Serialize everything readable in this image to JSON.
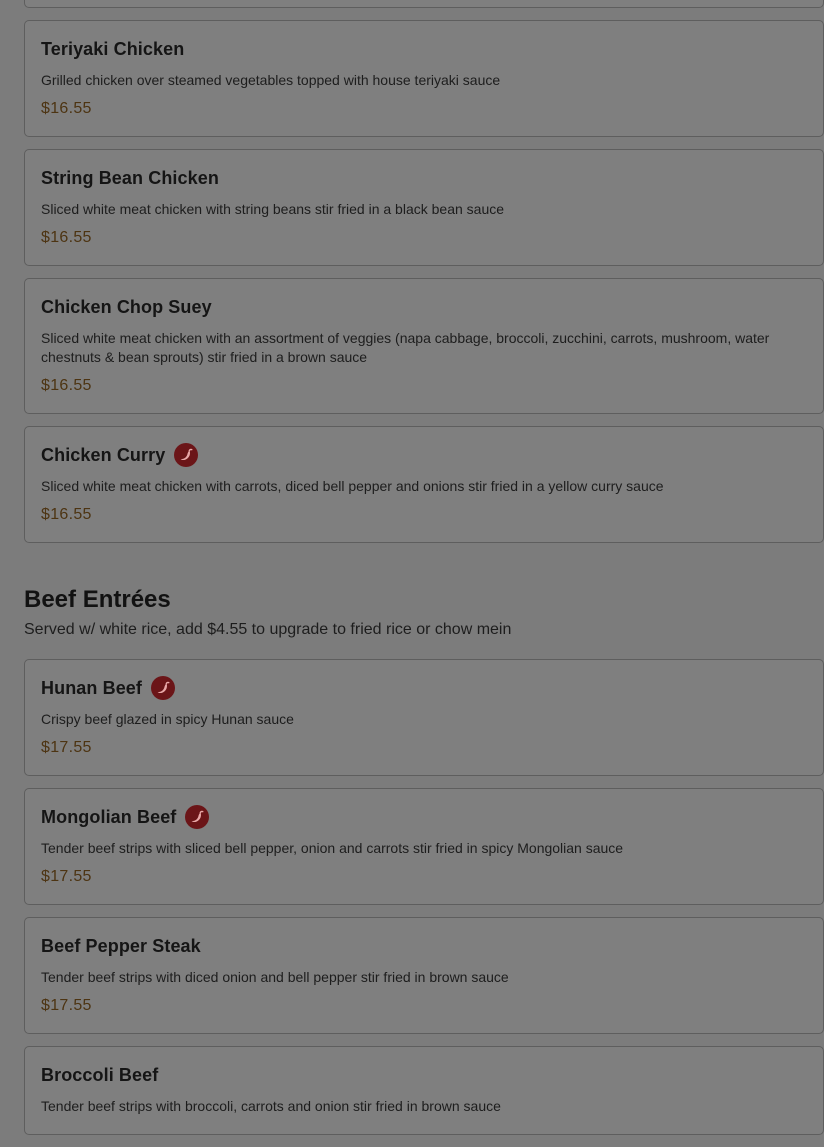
{
  "chicken_items": [
    {
      "name": "Teriyaki Chicken",
      "desc": "Grilled chicken over steamed vegetables topped with house teriyaki sauce",
      "price": "$16.55",
      "spicy": false
    },
    {
      "name": "String Bean Chicken",
      "desc": "Sliced white meat chicken with string beans stir fried in a black bean sauce",
      "price": "$16.55",
      "spicy": false
    },
    {
      "name": "Chicken Chop Suey",
      "desc": "Sliced white meat chicken with an assortment of veggies (napa cabbage, broccoli, zucchini, carrots, mushroom, water chestnuts & bean sprouts) stir fried in a brown sauce",
      "price": "$16.55",
      "spicy": false
    },
    {
      "name": "Chicken Curry",
      "desc": "Sliced white meat chicken with carrots, diced bell pepper and onions stir fried in a yellow curry sauce",
      "price": "$16.55",
      "spicy": true
    }
  ],
  "beef_section": {
    "title": "Beef Entrées",
    "subtitle": "Served w/ white rice, add $4.55 to upgrade to fried rice or chow mein"
  },
  "beef_items": [
    {
      "name": "Hunan Beef",
      "desc": "Crispy beef glazed in spicy Hunan sauce",
      "price": "$17.55",
      "spicy": true
    },
    {
      "name": "Mongolian Beef",
      "desc": "Tender beef strips with sliced bell pepper, onion and carrots stir fried in spicy Mongolian sauce",
      "price": "$17.55",
      "spicy": true
    },
    {
      "name": "Beef Pepper Steak",
      "desc": "Tender beef strips with diced onion and bell pepper stir fried in brown sauce",
      "price": "$17.55",
      "spicy": false
    },
    {
      "name": "Broccoli Beef",
      "desc": "Tender beef strips with broccoli, carrots and onion stir fried in brown sauce",
      "price": "",
      "spicy": false
    }
  ],
  "icons": {
    "spicy": "chili-pepper-icon"
  },
  "colors": {
    "spicy_badge": "#6b1518",
    "price": "#4d3412",
    "overlay": "#7c7c7c"
  }
}
